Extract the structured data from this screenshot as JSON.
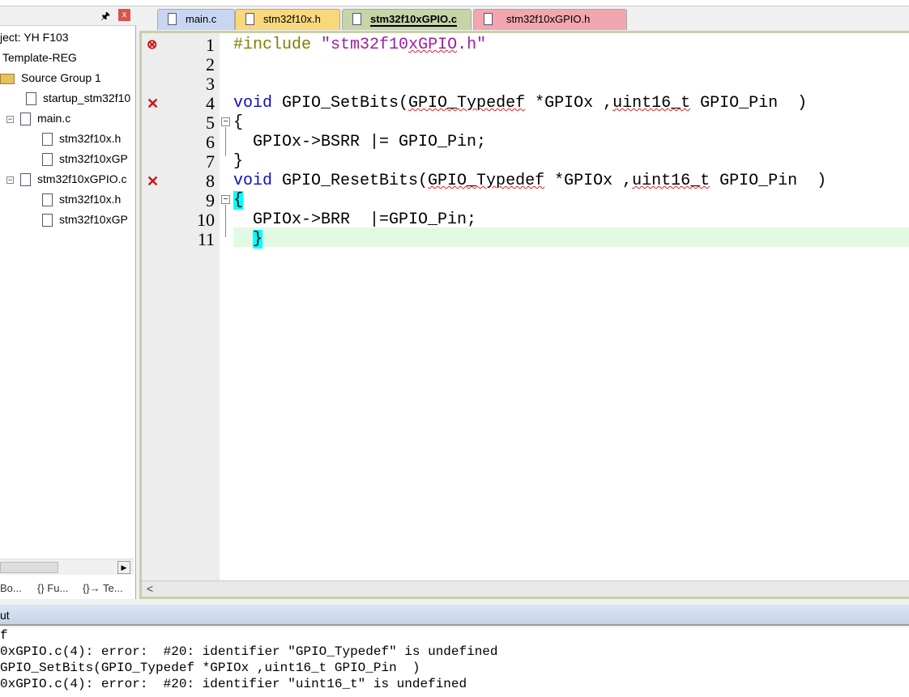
{
  "project_panel": {
    "items": [
      {
        "label": "ject: YH F103",
        "type": "root"
      },
      {
        "label": "Template-REG",
        "type": "target"
      },
      {
        "label": "Source Group 1",
        "type": "folder"
      },
      {
        "label": "startup_stm32f10",
        "type": "file"
      },
      {
        "label": "main.c",
        "type": "file-expanded"
      },
      {
        "label": "stm32f10x.h",
        "type": "child"
      },
      {
        "label": "stm32f10xGP",
        "type": "child"
      },
      {
        "label": "stm32f10xGPIO.c",
        "type": "file-expanded"
      },
      {
        "label": "stm32f10x.h",
        "type": "child"
      },
      {
        "label": "stm32f10xGP",
        "type": "child"
      }
    ],
    "bottom_tabs": [
      "Bo...",
      "{} Fu...",
      "{}→ Te..."
    ]
  },
  "editor_tabs": [
    {
      "label": "main.c",
      "color": "#c9d6f2"
    },
    {
      "label": "stm32f10x.h",
      "color": "#f9d87c"
    },
    {
      "label": "stm32f10xGPIO.c",
      "color": "#c6d4a6",
      "active": true
    },
    {
      "label": "stm32f10xGPIO.h",
      "color": "#f2a6ad"
    }
  ],
  "code_lines": [
    {
      "n": "1",
      "marker": "error-circle"
    },
    {
      "n": "2"
    },
    {
      "n": "3"
    },
    {
      "n": "4",
      "marker": "error-x"
    },
    {
      "n": "5"
    },
    {
      "n": "6"
    },
    {
      "n": "7"
    },
    {
      "n": "8",
      "marker": "error-x"
    },
    {
      "n": "9"
    },
    {
      "n": "10"
    },
    {
      "n": "11"
    }
  ],
  "code": {
    "l1a": "#include ",
    "l1b": "\"stm32f10",
    "l1c": "xGPIO",
    "l1d": ".h\"",
    "void": "void",
    "l4a": " GPIO_SetBits(",
    "l4b": "GPIO_Typedef",
    " l4c": "",
    "l4c": " *GPIOx ,",
    "l4d": "uint16_t",
    " l4e": "",
    "l4e": " GPIO_Pin  )",
    "l5": "{",
    "l6": "  GPIOx->BSRR |= GPIO_Pin;",
    "l7": "}",
    "l8a": " GPIO_ResetBits(",
    "l8b": "GPIO_Typedef",
    "l8c": " *GPIOx ,",
    "l8d": "uint16_t",
    "l8e": " GPIO_Pin  )",
    "l9": "{",
    "l10": "  GPIOx->BRR  |=GPIO_Pin;",
    "l11a": "  ",
    "l11b": "}"
  },
  "output": {
    "title": "ut",
    "lines": [
      "f",
      "0xGPIO.c(4): error:  #20: identifier \"GPIO_Typedef\" is undefined",
      "GPIO_SetBits(GPIO_Typedef *GPIOx ,uint16_t GPIO_Pin  )",
      "0xGPIO.c(4): error:  #20: identifier \"uint16_t\" is undefined"
    ]
  }
}
